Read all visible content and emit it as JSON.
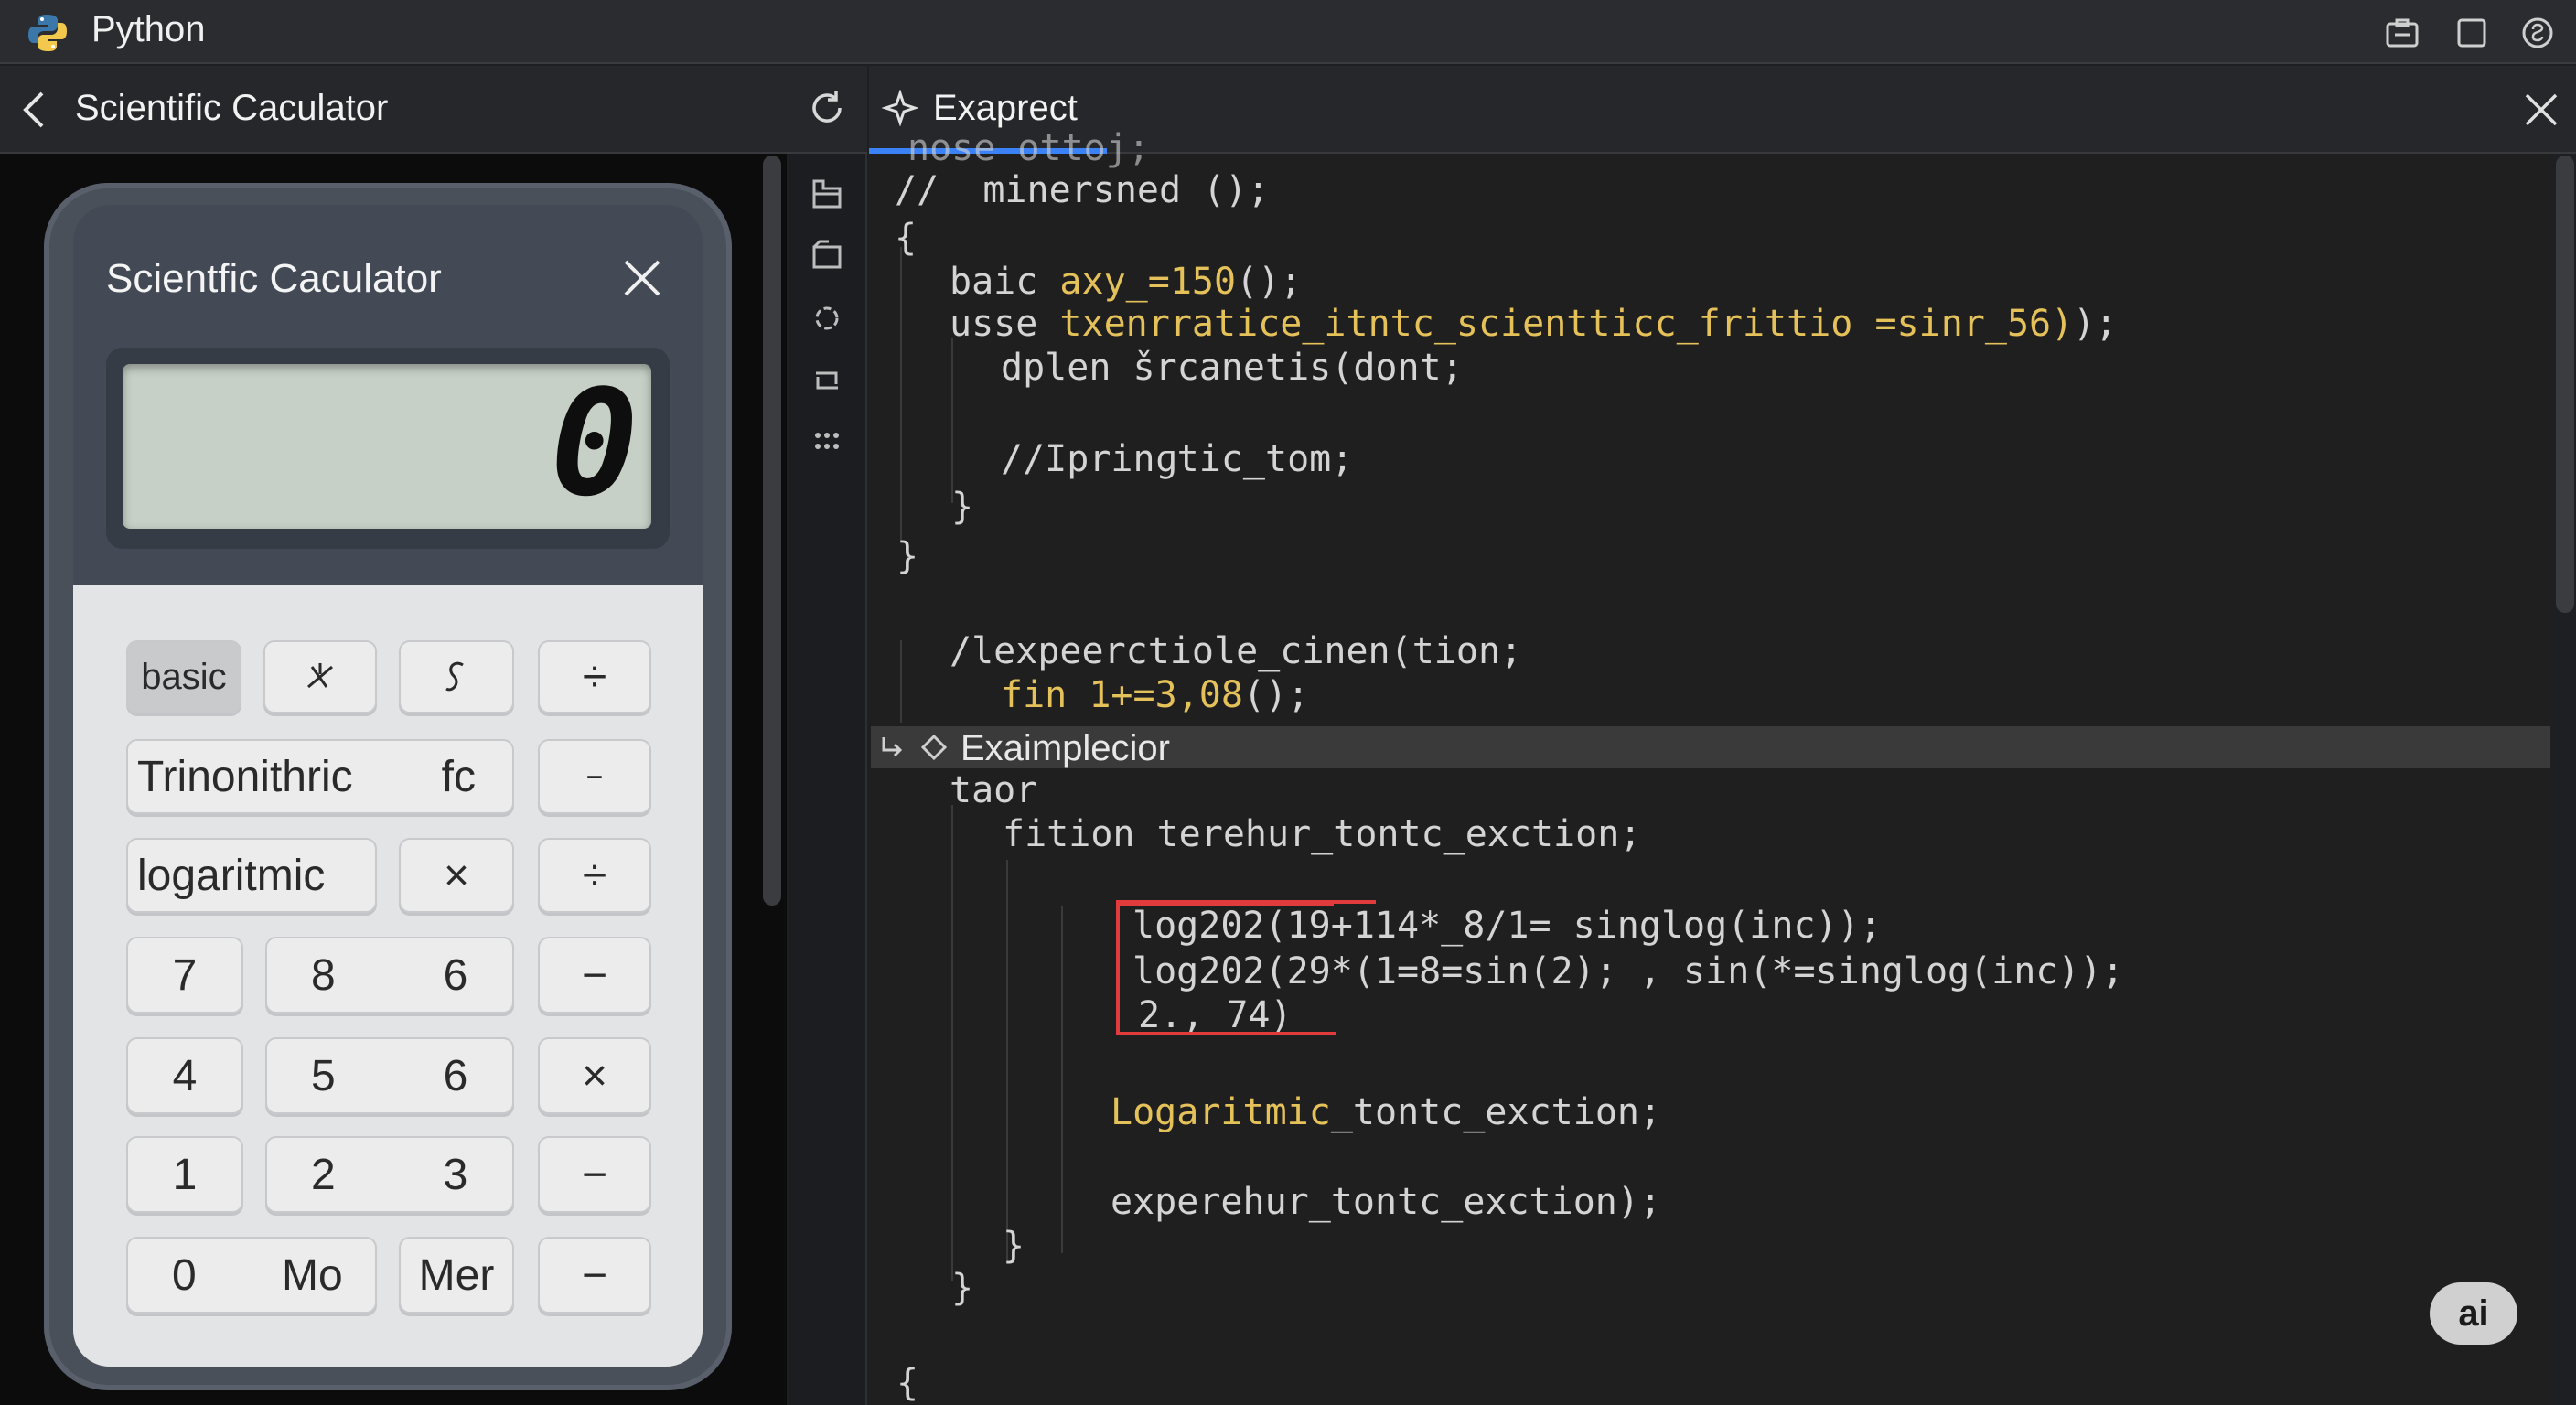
{
  "titlebar": {
    "app_title": "Python"
  },
  "left_panel": {
    "header_title": "Scientific Caculator"
  },
  "calculator": {
    "title": "Scientfic Caculator",
    "display_value": "0",
    "keys": {
      "basic": "basic",
      "trig": "Trinonithric",
      "fc": "fc",
      "log": "logaritmic",
      "div": "÷",
      "minus_small": "−",
      "times": "×",
      "div2": "÷",
      "n7": "7",
      "n8": "8",
      "n6a": "6",
      "minus1": "−",
      "n4": "4",
      "n5": "5",
      "n6b": "6",
      "times2": "×",
      "n1": "1",
      "n2": "2",
      "n3": "3",
      "minus2": "−",
      "n0": "0",
      "mo": "Mo",
      "mer": "Mer",
      "minus3": "−"
    }
  },
  "editor": {
    "tab_label": "Exaprect",
    "section_label": "Exaimplecior",
    "lines": {
      "l0": "nose ottoj;",
      "l1": "//  minersned ();",
      "l2": "{",
      "l3a": "baic ",
      "l3b": "axy_=150",
      "l3c": "();",
      "l4a": "usse ",
      "l4b": "txenrratice_itntc_scientticс_frittio =sinr_56)",
      "l4c": ");",
      "l5": "dplen šrcanetis(dont;",
      "l6": "//Iprinɡtic_tom;",
      "l7": "}",
      "l8": "}",
      "l9": "/lexpeerctiole_cinen(tion;",
      "l10a": "fin 1+=3,08",
      "l10b": "();",
      "l11": "taor",
      "l12": "fition terehur_tontc_exction;",
      "l13": "log202(19+114*_8/1= singlog(inc));",
      "l14": "log202(29*(1=8=sin(2); , sin(*=singlog(inc));",
      "l15": "2., 74)",
      "l16a": "Logaritmic",
      "l16b": "_tontc_exction;",
      "l17": "experehur_tontc_exction);",
      "l18": "}",
      "l19": "}",
      "l20": "{"
    }
  },
  "ai_badge": "ai",
  "colors": {
    "accent": "#3b82f6",
    "highlight": "#e23b3b",
    "code_yellow": "#e5c15a"
  }
}
